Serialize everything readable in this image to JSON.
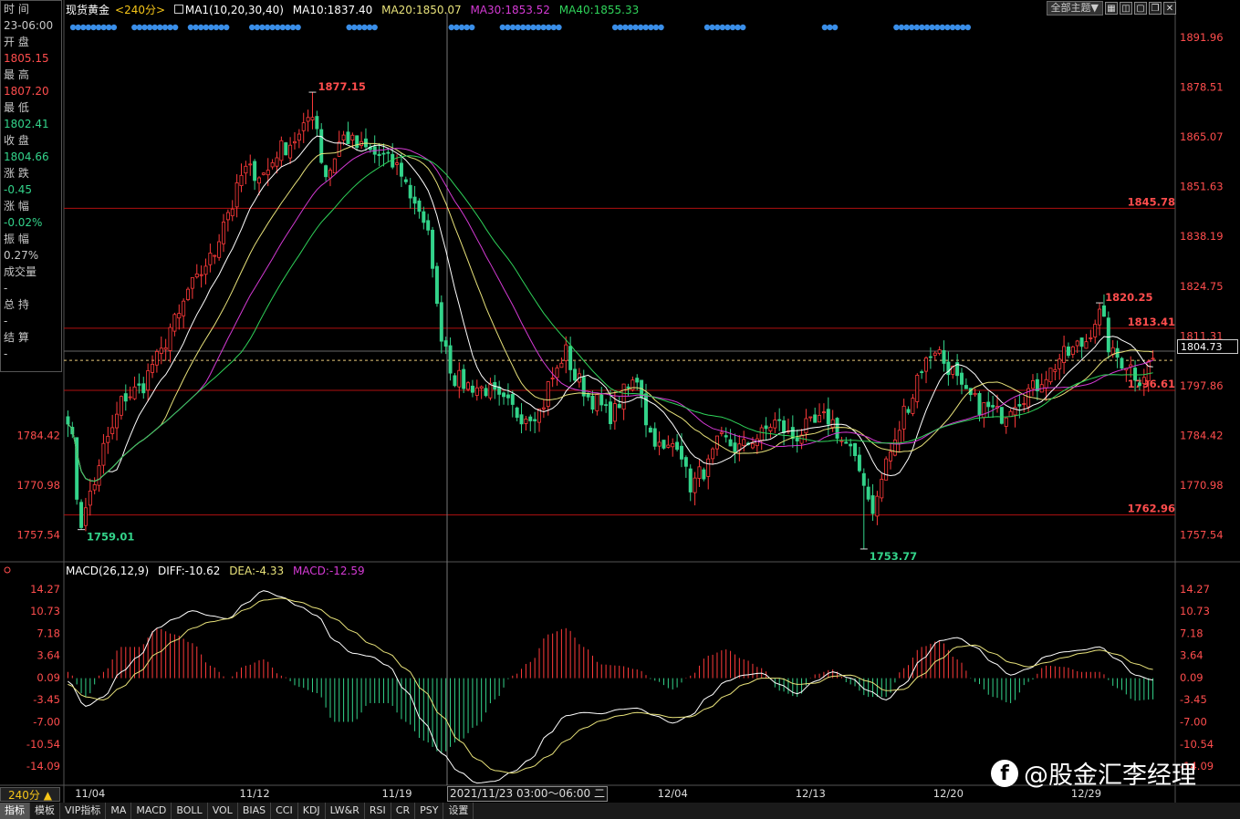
{
  "legend": {
    "symbol": "现货黄金",
    "period": "<240分>",
    "ma_name": "MA1(10,20,30,40)",
    "ma10": "MA10:1837.40",
    "ma20": "MA20:1850.07",
    "ma30": "MA30:1853.52",
    "ma40": "MA40:1855.33"
  },
  "colors": {
    "up": "#ff3a3a",
    "down": "#33d38a",
    "ma10": "#ffffff",
    "ma20": "#e8e27a",
    "ma30": "#d43ad4",
    "ma40": "#2fd35a",
    "dea": "#e8e27a",
    "grid": "#8b0000",
    "dots": "#3a8ee8"
  },
  "toolbar": {
    "theme": "全部主题▼",
    "icons": [
      "grid-icon",
      "layout-icon",
      "window-icon",
      "restore-icon",
      "close-icon"
    ]
  },
  "info": [
    {
      "label": "时 间",
      "value": "23-06:00",
      "color": "#c8c8c8"
    },
    {
      "label": "开 盘",
      "value": "1805.15",
      "color": "#ff4d4d"
    },
    {
      "label": "最 高",
      "value": "1807.20",
      "color": "#ff4d4d"
    },
    {
      "label": "最 低",
      "value": "1802.41",
      "color": "#33d38a"
    },
    {
      "label": "收 盘",
      "value": "1804.66",
      "color": "#33d38a"
    },
    {
      "label": "涨 跌",
      "value": "-0.45",
      "color": "#33d38a"
    },
    {
      "label": "涨 幅",
      "value": "-0.02%",
      "color": "#33d38a"
    },
    {
      "label": "振 幅",
      "value": "0.27%",
      "color": "#c8c8c8"
    },
    {
      "label": "成交量",
      "value": "-",
      "color": "#c8c8c8"
    },
    {
      "label": "总 持",
      "value": "-",
      "color": "#c8c8c8"
    },
    {
      "label": "结 算",
      "value": "-",
      "color": "#c8c8c8"
    }
  ],
  "macd_legend": {
    "name": "MACD(26,12,9)",
    "diff": "DIFF:-10.62",
    "dea": "DEA:-4.33",
    "macd": "MACD:-12.59"
  },
  "bottom": {
    "period_btn": "240分 ▲",
    "crosshair_date": "2021/11/23 03:00～06:00 二",
    "tabs": [
      "指标",
      "模板",
      "VIP指标",
      "MA",
      "MACD",
      "BOLL",
      "VOL",
      "BIAS",
      "CCI",
      "KDJ",
      "LW&R",
      "RSI",
      "CR",
      "PSY",
      "设置"
    ]
  },
  "current_price": "1804.73",
  "watermark": "@股金汇李经理",
  "chart_data": [
    {
      "type": "candlestick",
      "symbol": "现货黄金",
      "period": "240分",
      "ylim": [
        1750.8,
        1898.6
      ],
      "right_ticks": [
        "1891.96",
        "1878.51",
        "1865.07",
        "1851.63",
        "1838.19",
        "1824.75",
        "1811.31",
        "1797.86",
        "1784.42",
        "1770.98",
        "1757.54"
      ],
      "left_ticks": [
        "1784.42",
        "1770.98",
        "1757.54"
      ],
      "x_labels": [
        "11/04",
        "11/12",
        "11/19",
        "12/04",
        "12/13",
        "12/20",
        "12/29"
      ],
      "x_label_index": [
        5,
        42,
        74,
        136,
        167,
        198,
        229
      ],
      "hlines": [
        1845.78,
        1813.41,
        1796.61,
        1762.96
      ],
      "hline_labels": [
        "1845.78",
        "1813.41",
        "1796.61",
        "1762.96"
      ],
      "annotations": [
        {
          "text": "1877.15",
          "index": 55,
          "value": 1877.15,
          "kind": "high"
        },
        {
          "text": "1759.01",
          "index": 3,
          "value": 1759.01,
          "kind": "low"
        },
        {
          "text": "1820.25",
          "index": 232,
          "value": 1820.25,
          "kind": "high"
        },
        {
          "text": "1753.77",
          "index": 179,
          "value": 1753.77,
          "kind": "low"
        }
      ],
      "current_price": 1804.73,
      "waypoints": [
        [
          0,
          1790
        ],
        [
          3,
          1761
        ],
        [
          6,
          1772
        ],
        [
          9,
          1784
        ],
        [
          13,
          1795
        ],
        [
          16,
          1797
        ],
        [
          20,
          1805
        ],
        [
          24,
          1815
        ],
        [
          28,
          1825
        ],
        [
          32,
          1832
        ],
        [
          36,
          1845
        ],
        [
          40,
          1856
        ],
        [
          44,
          1855
        ],
        [
          48,
          1862
        ],
        [
          52,
          1865
        ],
        [
          55,
          1872
        ],
        [
          58,
          1855
        ],
        [
          62,
          1865
        ],
        [
          66,
          1862
        ],
        [
          70,
          1860
        ],
        [
          74,
          1857
        ],
        [
          78,
          1848
        ],
        [
          81,
          1838
        ],
        [
          84,
          1812
        ],
        [
          87,
          1800
        ],
        [
          90,
          1798
        ],
        [
          94,
          1797
        ],
        [
          98,
          1793
        ],
        [
          102,
          1790
        ],
        [
          106,
          1791
        ],
        [
          109,
          1800
        ],
        [
          112,
          1807
        ],
        [
          114,
          1800
        ],
        [
          118,
          1794
        ],
        [
          122,
          1790
        ],
        [
          126,
          1797
        ],
        [
          128,
          1800
        ],
        [
          131,
          1785
        ],
        [
          134,
          1780
        ],
        [
          137,
          1783
        ],
        [
          140,
          1771
        ],
        [
          143,
          1775
        ],
        [
          147,
          1783
        ],
        [
          151,
          1781
        ],
        [
          155,
          1784
        ],
        [
          159,
          1788
        ],
        [
          163,
          1784
        ],
        [
          167,
          1787
        ],
        [
          171,
          1789
        ],
        [
          175,
          1782
        ],
        [
          178,
          1775
        ],
        [
          181,
          1765
        ],
        [
          185,
          1780
        ],
        [
          189,
          1793
        ],
        [
          192,
          1803
        ],
        [
          195,
          1808
        ],
        [
          198,
          1803
        ],
        [
          202,
          1795
        ],
        [
          206,
          1792
        ],
        [
          210,
          1790
        ],
        [
          213,
          1794
        ],
        [
          217,
          1797
        ],
        [
          220,
          1801
        ],
        [
          224,
          1806
        ],
        [
          228,
          1809
        ],
        [
          232,
          1817
        ],
        [
          235,
          1806
        ],
        [
          238,
          1804
        ],
        [
          241,
          1800
        ],
        [
          244,
          1805
        ]
      ],
      "signal_dots_index": [
        [
          1,
          9
        ],
        [
          13,
          21
        ],
        [
          24,
          31
        ],
        [
          36,
          45
        ],
        [
          55,
          60
        ],
        [
          75,
          79
        ],
        [
          85,
          96
        ],
        [
          107,
          116
        ],
        [
          125,
          132
        ],
        [
          148,
          150
        ],
        [
          162,
          176
        ]
      ]
    },
    {
      "type": "macd",
      "name": "MACD(26,12,9)",
      "ylim": [
        -17.0,
        16.0
      ],
      "ticks": [
        "14.27",
        "10.73",
        "7.18",
        "3.64",
        "0.09",
        "-3.45",
        "-7.00",
        "-10.54",
        "-14.09"
      ],
      "diff_waypoints": [
        [
          0,
          -0.5
        ],
        [
          4,
          -4.5
        ],
        [
          8,
          -3
        ],
        [
          12,
          1
        ],
        [
          16,
          3.5
        ],
        [
          20,
          8
        ],
        [
          24,
          9.5
        ],
        [
          28,
          10.8
        ],
        [
          32,
          10
        ],
        [
          36,
          9.5
        ],
        [
          40,
          12
        ],
        [
          44,
          14
        ],
        [
          48,
          13
        ],
        [
          52,
          11.5
        ],
        [
          56,
          10
        ],
        [
          60,
          6
        ],
        [
          64,
          4
        ],
        [
          68,
          3.5
        ],
        [
          72,
          2
        ],
        [
          76,
          -2
        ],
        [
          80,
          -7
        ],
        [
          84,
          -12
        ],
        [
          88,
          -15
        ],
        [
          92,
          -16.8
        ],
        [
          96,
          -16.5
        ],
        [
          100,
          -15
        ],
        [
          104,
          -13
        ],
        [
          108,
          -9
        ],
        [
          112,
          -6
        ],
        [
          116,
          -5.5
        ],
        [
          120,
          -5.7
        ],
        [
          124,
          -5
        ],
        [
          128,
          -4.8
        ],
        [
          132,
          -6
        ],
        [
          136,
          -7.2
        ],
        [
          140,
          -6
        ],
        [
          144,
          -3
        ],
        [
          148,
          -0.5
        ],
        [
          152,
          0.5
        ],
        [
          156,
          0.8
        ],
        [
          160,
          -1
        ],
        [
          164,
          -2.5
        ],
        [
          168,
          -0.5
        ],
        [
          172,
          1
        ],
        [
          176,
          0
        ],
        [
          180,
          -2
        ],
        [
          184,
          -3.5
        ],
        [
          188,
          -1
        ],
        [
          192,
          3
        ],
        [
          196,
          6
        ],
        [
          200,
          6.5
        ],
        [
          204,
          5
        ],
        [
          208,
          2.5
        ],
        [
          212,
          0.5
        ],
        [
          216,
          1.5
        ],
        [
          220,
          3.5
        ],
        [
          224,
          4.2
        ],
        [
          228,
          4.5
        ],
        [
          232,
          5
        ],
        [
          236,
          3
        ],
        [
          240,
          0.5
        ],
        [
          244,
          -0.3
        ]
      ],
      "dea_waypoints": [
        [
          0,
          -1
        ],
        [
          4,
          -3
        ],
        [
          8,
          -3.5
        ],
        [
          12,
          -1.5
        ],
        [
          16,
          1
        ],
        [
          20,
          4
        ],
        [
          24,
          6
        ],
        [
          28,
          8
        ],
        [
          32,
          9
        ],
        [
          36,
          9.5
        ],
        [
          40,
          11
        ],
        [
          44,
          12.5
        ],
        [
          48,
          12.8
        ],
        [
          52,
          12.2
        ],
        [
          56,
          11.2
        ],
        [
          60,
          9.5
        ],
        [
          64,
          7.5
        ],
        [
          68,
          5.5
        ],
        [
          72,
          4
        ],
        [
          76,
          1.5
        ],
        [
          80,
          -2
        ],
        [
          84,
          -6
        ],
        [
          88,
          -10
        ],
        [
          92,
          -13
        ],
        [
          96,
          -14.8
        ],
        [
          100,
          -15.2
        ],
        [
          104,
          -14.3
        ],
        [
          108,
          -12.5
        ],
        [
          112,
          -10
        ],
        [
          116,
          -8
        ],
        [
          120,
          -6.8
        ],
        [
          124,
          -6
        ],
        [
          128,
          -5.5
        ],
        [
          132,
          -5.8
        ],
        [
          136,
          -6.3
        ],
        [
          140,
          -6.2
        ],
        [
          144,
          -4.8
        ],
        [
          148,
          -2.8
        ],
        [
          152,
          -1
        ],
        [
          156,
          0
        ],
        [
          160,
          0
        ],
        [
          164,
          -1
        ],
        [
          168,
          -0.8
        ],
        [
          172,
          0.3
        ],
        [
          176,
          0.5
        ],
        [
          180,
          -0.5
        ],
        [
          184,
          -2
        ],
        [
          188,
          -1.8
        ],
        [
          192,
          0.5
        ],
        [
          196,
          3
        ],
        [
          200,
          5
        ],
        [
          204,
          5.3
        ],
        [
          208,
          4
        ],
        [
          212,
          2.5
        ],
        [
          216,
          1.8
        ],
        [
          220,
          2.5
        ],
        [
          224,
          3.3
        ],
        [
          228,
          4
        ],
        [
          232,
          4.5
        ],
        [
          236,
          3.8
        ],
        [
          240,
          2.3
        ],
        [
          244,
          1.4
        ]
      ]
    }
  ]
}
